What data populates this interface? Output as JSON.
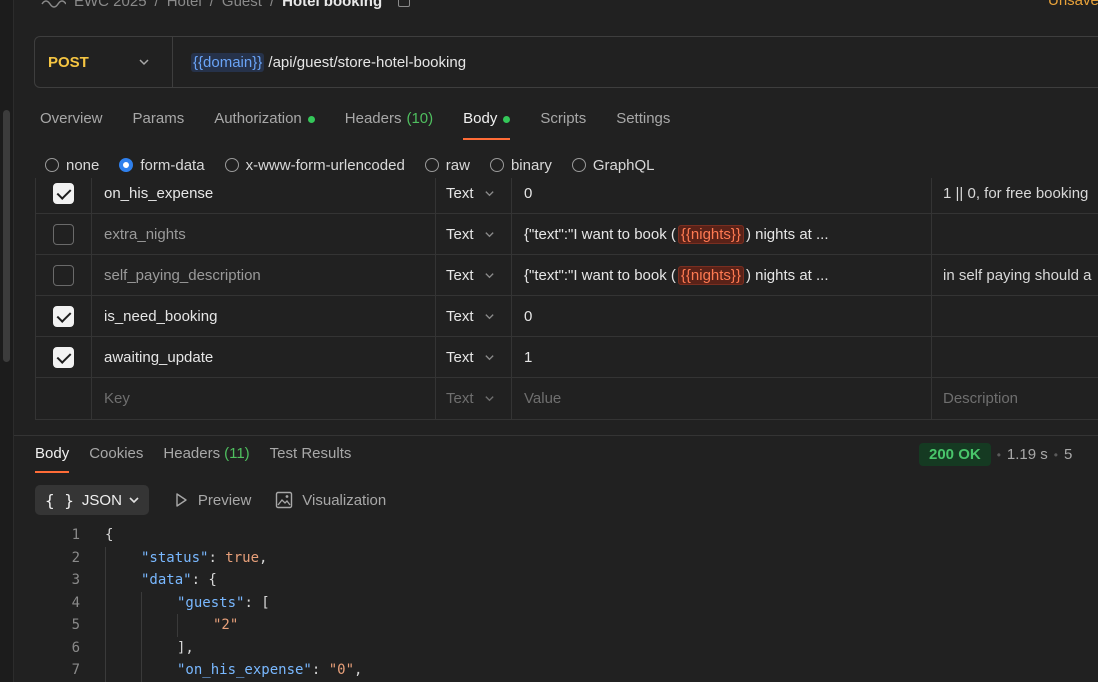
{
  "breadcrumb": {
    "items": [
      "EWC 2025",
      "Hotel",
      "Guest"
    ],
    "current": "Hotel booking",
    "unsaved": "Unsaved"
  },
  "request": {
    "method": "POST",
    "url_var": "{{domain}}",
    "url_path": "/api/guest/store-hotel-booking"
  },
  "request_tabs": [
    {
      "label": "Overview"
    },
    {
      "label": "Params"
    },
    {
      "label": "Authorization",
      "dot": true
    },
    {
      "label": "Headers",
      "count": "(10)"
    },
    {
      "label": "Body",
      "dot": true,
      "active": true
    },
    {
      "label": "Scripts"
    },
    {
      "label": "Settings"
    }
  ],
  "body_types": [
    {
      "label": "none",
      "checked": false
    },
    {
      "label": "form-data",
      "checked": true
    },
    {
      "label": "x-www-form-urlencoded",
      "checked": false
    },
    {
      "label": "raw",
      "checked": false
    },
    {
      "label": "binary",
      "checked": false
    },
    {
      "label": "GraphQL",
      "checked": false
    }
  ],
  "params": [
    {
      "checked": true,
      "key": "on_his_expense",
      "type": "Text",
      "value": "0",
      "description": "1 || 0, for free booking"
    },
    {
      "checked": false,
      "key": "extra_nights",
      "type": "Text",
      "value_pre": "{\"text\":\"I want to book (",
      "value_var": "{{nights}}",
      "value_post": ") nights at ...",
      "description": ""
    },
    {
      "checked": false,
      "key": "self_paying_description",
      "type": "Text",
      "value_pre": "{\"text\":\"I want to book (",
      "value_var": "{{nights}}",
      "value_post": ") nights at ...",
      "description": "in self paying should a"
    },
    {
      "checked": true,
      "key": "is_need_booking",
      "type": "Text",
      "value": "0",
      "description": ""
    },
    {
      "checked": true,
      "key": "awaiting_update",
      "type": "Text",
      "value": "1",
      "description": ""
    }
  ],
  "params_placeholder": {
    "key": "Key",
    "type": "Text",
    "value": "Value",
    "description": "Description"
  },
  "response_tabs": [
    {
      "label": "Body",
      "active": true
    },
    {
      "label": "Cookies"
    },
    {
      "label": "Headers",
      "count": "(11)"
    },
    {
      "label": "Test Results"
    }
  ],
  "response_status": {
    "badge": "200 OK",
    "time": "1.19 s",
    "size": "5"
  },
  "response_toolbar": {
    "format": "JSON",
    "preview": "Preview",
    "visualization": "Visualization"
  },
  "code_lines": [
    {
      "n": "1",
      "indent": 0,
      "parts": [
        [
          "p",
          "{"
        ]
      ]
    },
    {
      "n": "2",
      "indent": 1,
      "parts": [
        [
          "k",
          "\"status\""
        ],
        [
          "p",
          ": "
        ],
        [
          "b",
          "true"
        ],
        [
          "p",
          ","
        ]
      ]
    },
    {
      "n": "3",
      "indent": 1,
      "parts": [
        [
          "k",
          "\"data\""
        ],
        [
          "p",
          ": {"
        ]
      ]
    },
    {
      "n": "4",
      "indent": 2,
      "parts": [
        [
          "k",
          "\"guests\""
        ],
        [
          "p",
          ": ["
        ]
      ]
    },
    {
      "n": "5",
      "indent": 3,
      "parts": [
        [
          "s",
          "\"2\""
        ]
      ]
    },
    {
      "n": "6",
      "indent": 2,
      "parts": [
        [
          "p",
          "],"
        ]
      ]
    },
    {
      "n": "7",
      "indent": 2,
      "parts": [
        [
          "k",
          "\"on_his_expense\""
        ],
        [
          "p",
          ": "
        ],
        [
          "s",
          "\"0\""
        ],
        [
          "p",
          ","
        ]
      ]
    }
  ],
  "colors": {
    "accent": "#ff6c37",
    "method": "#f5c542",
    "success": "#49c56b",
    "radio": "#2f80ed"
  }
}
